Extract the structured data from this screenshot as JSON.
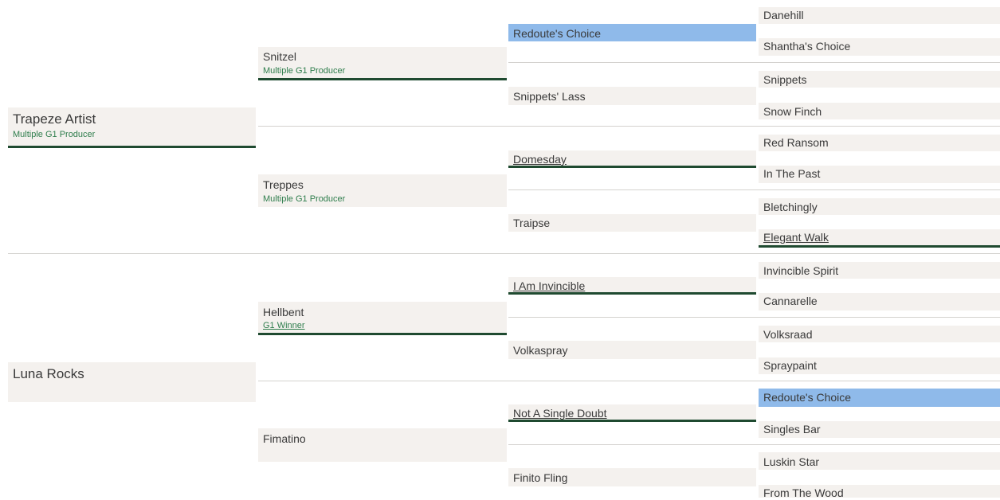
{
  "pedigree": {
    "subject": {},
    "sire": {
      "name": "Trapeze Artist",
      "tag": "Multiple G1 Producer"
    },
    "dam": {
      "name": "Luna Rocks"
    },
    "gen2": [
      {
        "name": "Snitzel",
        "tag": "Multiple G1 Producer"
      },
      {
        "name": "Treppes",
        "tag": "Multiple G1 Producer"
      },
      {
        "name": "Hellbent",
        "tag": "G1 Winner"
      },
      {
        "name": "Fimatino"
      }
    ],
    "gen3": [
      {
        "name": "Redoute's Choice",
        "highlighted": true
      },
      {
        "name": "Snippets' Lass"
      },
      {
        "name": "Domesday"
      },
      {
        "name": "Traipse"
      },
      {
        "name": "I Am Invincible"
      },
      {
        "name": "Volkaspray"
      },
      {
        "name": "Not A Single Doubt"
      },
      {
        "name": "Finito Fling"
      }
    ],
    "gen4": [
      {
        "name": "Danehill"
      },
      {
        "name": "Shantha's Choice"
      },
      {
        "name": "Snippets"
      },
      {
        "name": "Snow Finch"
      },
      {
        "name": "Red Ransom"
      },
      {
        "name": "In The Past"
      },
      {
        "name": "Bletchingly"
      },
      {
        "name": "Elegant Walk"
      },
      {
        "name": "Invincible Spirit"
      },
      {
        "name": "Cannarelle"
      },
      {
        "name": "Volksraad"
      },
      {
        "name": "Spraypaint"
      },
      {
        "name": "Redoute's Choice",
        "highlighted": true
      },
      {
        "name": "Singles Bar"
      },
      {
        "name": "Luskin Star"
      },
      {
        "name": "From The Wood"
      }
    ],
    "colors": {
      "cell_bg": "#f4f1ee",
      "highlight": "#8fbaea",
      "underline": "#1f4a30",
      "tag_text": "#2e7d4c",
      "divider": "#d4d2cf"
    }
  }
}
